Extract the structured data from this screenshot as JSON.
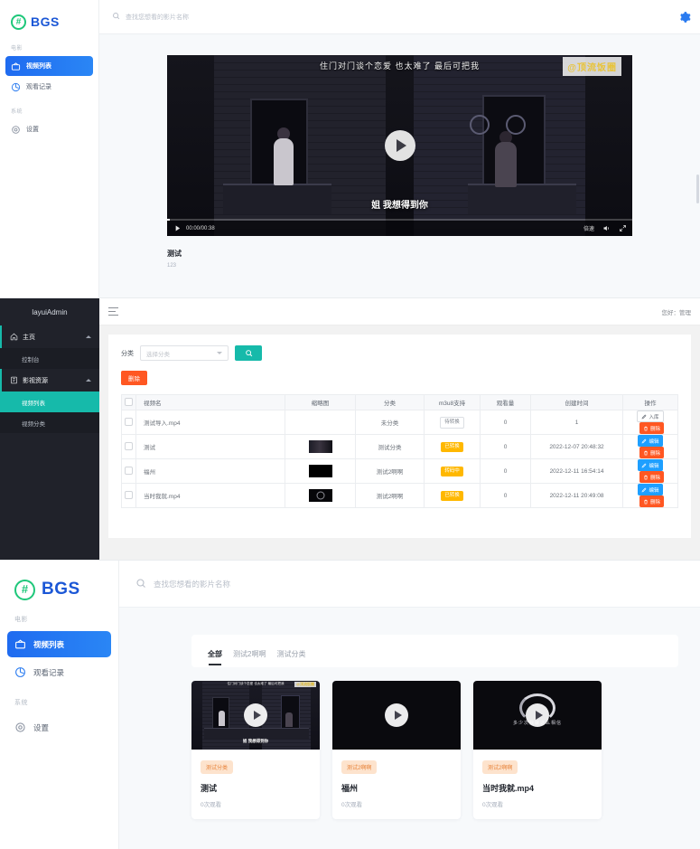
{
  "panel1": {
    "brand": {
      "mark": "#",
      "text": "BGS"
    },
    "search": {
      "placeholder": "查找您想看的影片名称",
      "icon": "search-icon"
    },
    "gear_icon": "gear-icon",
    "sidebar": {
      "groups": [
        {
          "label": "电影",
          "items": [
            {
              "label": "视频列表",
              "icon": "tv-icon",
              "active": true
            },
            {
              "label": "观看记录",
              "icon": "history-pie-icon",
              "active": false
            }
          ]
        },
        {
          "label": "系统",
          "items": [
            {
              "label": "设置",
              "icon": "gear-icon",
              "active": false
            }
          ]
        }
      ]
    },
    "player": {
      "overlay_top": "住门对门谈个恋爱 也太难了 最后可把我",
      "watermark": "@顶流饭圈",
      "subtitle": "姐 我想得到你",
      "time": "00:00/00:38",
      "speed_label": "倍速",
      "play_icon": "play-icon",
      "volume_icon": "volume-icon",
      "fullscreen_icon": "fullscreen-icon"
    },
    "video_title": "测试",
    "video_desc": "123"
  },
  "panel2": {
    "logo": "layuiAdmin",
    "greeting": "您好：管理",
    "nav": [
      {
        "label": "主页",
        "icon": "home-icon",
        "expanded": true,
        "children": [
          {
            "label": "控制台",
            "active": false
          }
        ]
      },
      {
        "label": "影视资源",
        "icon": "film-icon",
        "expanded": true,
        "children": [
          {
            "label": "视频列表",
            "active": true
          },
          {
            "label": "视频分类",
            "active": false
          }
        ]
      }
    ],
    "filter": {
      "label": "分类",
      "select_placeholder": "选择分类",
      "search_icon": "search-icon"
    },
    "delete_button": "删除",
    "table": {
      "columns": [
        "视频名",
        "缩略图",
        "分类",
        "m3u8支持",
        "观看量",
        "创建时间",
        "操作"
      ],
      "rows": [
        {
          "name": "测试导入.mp4",
          "thumb": "none",
          "category": "未分类",
          "m3u8": "待转换",
          "m3u8_state": "wait",
          "views": "0",
          "created": "1",
          "action_primary": "入库",
          "action_primary_style": "store",
          "action_delete": "删除"
        },
        {
          "name": "测试",
          "thumb": "t1",
          "category": "测试分类",
          "m3u8": "已转换",
          "m3u8_state": "done",
          "views": "0",
          "created": "2022-12-07 20:48:32",
          "action_primary": "编辑",
          "action_primary_style": "edit",
          "action_delete": "删除"
        },
        {
          "name": "福州",
          "thumb": "t2",
          "category": "测试2啊啊",
          "m3u8": "转码中",
          "m3u8_state": "prog",
          "views": "0",
          "created": "2022-12-11 16:54:14",
          "action_primary": "编辑",
          "action_primary_style": "edit",
          "action_delete": "删除"
        },
        {
          "name": "当时我就.mp4",
          "thumb": "t3",
          "category": "测试2啊啊",
          "m3u8": "已转换",
          "m3u8_state": "done",
          "views": "0",
          "created": "2022-12-11 20:49:08",
          "action_primary": "编辑",
          "action_primary_style": "edit",
          "action_delete": "删除"
        }
      ]
    }
  },
  "panel3": {
    "brand": {
      "mark": "#",
      "text": "BGS"
    },
    "search": {
      "placeholder": "查找您想看的影片名称",
      "icon": "search-icon"
    },
    "sidebar": {
      "groups": [
        {
          "label": "电影",
          "items": [
            {
              "label": "视频列表",
              "icon": "tv-icon",
              "active": true
            },
            {
              "label": "观看记录",
              "icon": "history-pie-icon",
              "active": false
            }
          ]
        },
        {
          "label": "系统",
          "items": [
            {
              "label": "设置",
              "icon": "gear-icon",
              "active": false
            }
          ]
        }
      ]
    },
    "tabs": [
      {
        "label": "全部",
        "active": true
      },
      {
        "label": "测试2啊啊",
        "active": false
      },
      {
        "label": "测试分类",
        "active": false
      }
    ],
    "cards": [
      {
        "badge": "测试分类",
        "title": "测试",
        "views": "0次观看",
        "thumb": "c1",
        "overlay_top": "住门对门谈个恋爱 也太难了 最后可把我",
        "watermark": "@顶流饭圈",
        "subtitle": "姐 我想得到你"
      },
      {
        "badge": "测试2啊啊",
        "title": "福州",
        "views": "0次观看",
        "thumb": "c2"
      },
      {
        "badge": "测试2啊啊",
        "title": "当时我就.mp4",
        "views": "0次观看",
        "thumb": "c3",
        "caption": "多少次我就这么相信"
      }
    ]
  },
  "colors": {
    "accent_blue": "#2a7bf0",
    "brand_green": "#1ec77a",
    "brand_blue": "#1b57d6",
    "layui_teal": "#16baaa",
    "layui_orange": "#ff5722",
    "badge_orange": "#ffb800",
    "card_badge_bg": "#fde3cd",
    "card_badge_fg": "#e8833a"
  }
}
